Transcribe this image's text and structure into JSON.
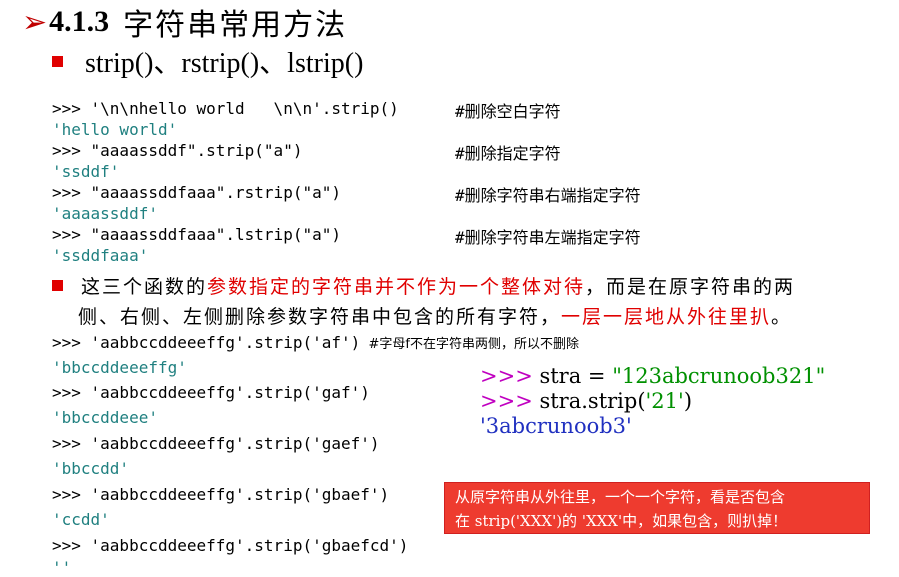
{
  "title": {
    "arrow": "➢",
    "number": "4.1.3",
    "text": "字符串常用方法"
  },
  "subtitle": "strip()、rstrip()、lstrip()",
  "block1": [
    {
      "code": ">>> '\\n\\nhello world   \\n\\n'.strip()",
      "comment": "#删除空白字符",
      "output": "'hello world'"
    },
    {
      "code": ">>> \"aaaassddf\".strip(\"a\")",
      "comment": "#删除指定字符",
      "output": "'ssddf'"
    },
    {
      "code": ">>> \"aaaassddfaaa\".rstrip(\"a\")",
      "comment": "#删除字符串右端指定字符",
      "output": "'aaaassddf'"
    },
    {
      "code": ">>> \"aaaassddfaaa\".lstrip(\"a\")",
      "comment": "#删除字符串左端指定字符",
      "output": "'ssddfaaa'"
    }
  ],
  "paragraph": {
    "p1": "这三个函数的",
    "p2": "参数指定的字符串并不作为一个整体对待",
    "p3": "，而是在原字符串的两",
    "p4": "侧、右侧、左侧删除参数字符串中包含的所有字符，",
    "p5": "一层一层地从外往里扒",
    "p6": "。"
  },
  "block2": [
    {
      "code": ">>> 'aabbccddeeeffg'.strip('af')",
      "comment": "  #字母f不在字符串两侧，所以不删除",
      "output": "'bbccddeeeffg'"
    },
    {
      "code": ">>> 'aabbccddeeeffg'.strip('gaf')",
      "comment": "",
      "output": "'bbccddeee'"
    },
    {
      "code": ">>> 'aabbccddeeeffg'.strip('gaef')",
      "comment": "",
      "output": "'bbccdd'"
    },
    {
      "code": ">>> 'aabbccddeeeffg'.strip('gbaef')",
      "comment": "",
      "output": "'ccdd'"
    },
    {
      "code": ">>> 'aabbccddeeeffg'.strip('gbaefcd')",
      "comment": "",
      "output": "''"
    }
  ],
  "demo": {
    "prompt": ">>> ",
    "line1a": "stra = ",
    "line1b": "\"123abcrunoob321\"",
    "line2a": "stra.strip(",
    "line2b": "'21'",
    "line2c": ")",
    "line3": "'3abcrunoob3'"
  },
  "note": {
    "line1": "从原字符串从外往里，一个一个字符，看是否包含",
    "line2": "在 strip('XXX')的 'XXX'中，如果包含，则扒掉！"
  },
  "colors": {
    "accent_red": "#e00000",
    "output_teal": "#208080",
    "note_bg": "#ee3b2f"
  }
}
